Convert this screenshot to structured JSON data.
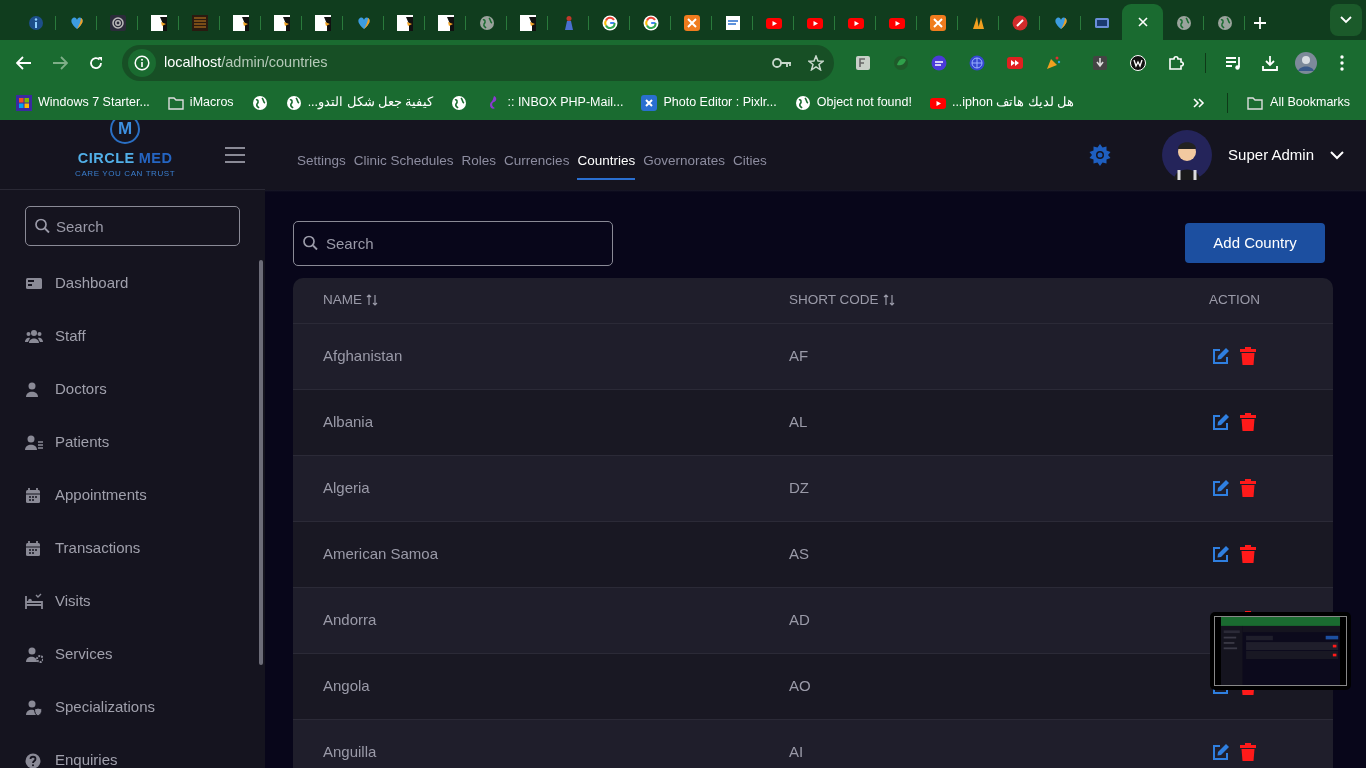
{
  "browser": {
    "tabs": [
      {
        "selected": false
      },
      {
        "selected": false
      },
      {
        "selected": false
      },
      {
        "selected": false
      },
      {
        "selected": false
      },
      {
        "selected": false
      },
      {
        "selected": false
      },
      {
        "selected": false
      },
      {
        "selected": false
      },
      {
        "selected": false
      },
      {
        "selected": false
      },
      {
        "selected": false
      },
      {
        "selected": false
      },
      {
        "selected": false
      },
      {
        "selected": false
      },
      {
        "selected": false
      },
      {
        "selected": false
      },
      {
        "selected": false
      },
      {
        "selected": false
      },
      {
        "selected": false
      },
      {
        "selected": false
      },
      {
        "selected": false
      },
      {
        "selected": false
      },
      {
        "selected": false
      },
      {
        "selected": false
      },
      {
        "selected": false
      },
      {
        "selected": false
      },
      {
        "selected": true
      },
      {
        "selected": false
      },
      {
        "selected": false
      }
    ],
    "address_bar": {
      "host": "localhost",
      "path": "/admin/countries"
    },
    "bookmarks": [
      {
        "kind": "link",
        "label": "Windows 7 Starter..."
      },
      {
        "kind": "link",
        "label": "iMacros"
      },
      {
        "kind": "icon"
      },
      {
        "kind": "link",
        "label": "كيفية جعل شكل التدو..."
      },
      {
        "kind": "icon"
      },
      {
        "kind": "link",
        "label": ":: INBOX PHP-Mail..."
      },
      {
        "kind": "link",
        "label": "Photo Editor : Pixlr..."
      },
      {
        "kind": "link",
        "label": "Object not found!"
      },
      {
        "kind": "link",
        "label": "هل لديك هاتف iphon..."
      }
    ],
    "all_bookmarks": "All Bookmarks"
  },
  "app": {
    "brand": {
      "mark": "M",
      "name_first": "CIRCLE",
      "name_second": "MED",
      "tagline": "CARE YOU CAN TRUST"
    },
    "sidebar": {
      "search_placeholder": "Search",
      "items": [
        {
          "label": "Dashboard"
        },
        {
          "label": "Staff"
        },
        {
          "label": "Doctors"
        },
        {
          "label": "Patients"
        },
        {
          "label": "Appointments"
        },
        {
          "label": "Transactions"
        },
        {
          "label": "Visits"
        },
        {
          "label": "Services"
        },
        {
          "label": "Specializations"
        },
        {
          "label": "Enquiries"
        }
      ]
    },
    "top_nav": [
      {
        "label": "Settings",
        "selected": false
      },
      {
        "label": "Clinic Schedules",
        "selected": false
      },
      {
        "label": "Roles",
        "selected": false
      },
      {
        "label": "Currencies",
        "selected": false
      },
      {
        "label": "Countries",
        "selected": true
      },
      {
        "label": "Governorates",
        "selected": false
      },
      {
        "label": "Cities",
        "selected": false
      }
    ],
    "user": {
      "name": "Super Admin"
    },
    "search": {
      "placeholder": "Search"
    },
    "add_button": "Add Country",
    "table": {
      "columns": [
        {
          "label": "NAME",
          "sortable": true
        },
        {
          "label": "SHORT CODE",
          "sortable": true
        },
        {
          "label": "ACTION",
          "sortable": false
        }
      ],
      "rows": [
        {
          "name": "Afghanistan",
          "code": "AF"
        },
        {
          "name": "Albania",
          "code": "AL"
        },
        {
          "name": "Algeria",
          "code": "DZ"
        },
        {
          "name": "American Samoa",
          "code": "AS"
        },
        {
          "name": "Andorra",
          "code": "AD"
        },
        {
          "name": "Angola",
          "code": "AO"
        },
        {
          "name": "Anguilla",
          "code": "AI"
        }
      ]
    }
  }
}
